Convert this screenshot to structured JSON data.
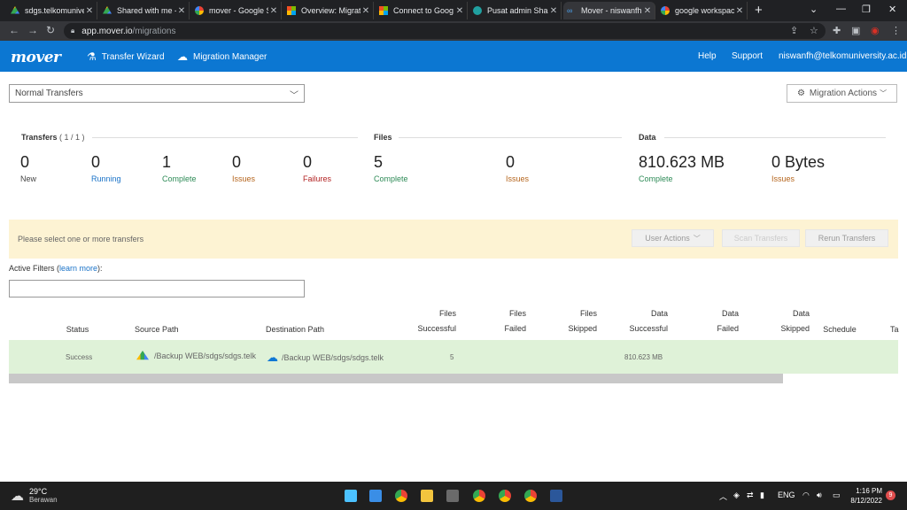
{
  "browser": {
    "tabs": [
      {
        "label": "sdgs.telkomunive",
        "icon": "google-drive-icon"
      },
      {
        "label": "Shared with me -",
        "icon": "google-drive-icon"
      },
      {
        "label": "mover - Google S",
        "icon": "google-icon"
      },
      {
        "label": "Overview: Migrat",
        "icon": "microsoft-icon"
      },
      {
        "label": "Connect to Goog",
        "icon": "microsoft-icon"
      },
      {
        "label": "Pusat admin Sha",
        "icon": "sharepoint-icon"
      },
      {
        "label": "Mover - niswanfh",
        "icon": "mover-icon"
      },
      {
        "label": "google workspac",
        "icon": "google-icon"
      }
    ],
    "url_host": "app.mover.io",
    "url_path": "/migrations"
  },
  "header": {
    "logo": "mover",
    "nav": [
      {
        "label": "Transfer Wizard",
        "icon": "flask-icon"
      },
      {
        "label": "Migration Manager",
        "icon": "cloud-upload-icon"
      }
    ],
    "help": "Help",
    "support": "Support",
    "user": "niswanfh@telkomuniversity.ac.id"
  },
  "main": {
    "transfer_type": "Normal Transfers",
    "migration_actions": "Migration Actions",
    "transfers_head": "Transfers",
    "transfers_count": "( 1 / 1 )",
    "files_head": "Files",
    "data_head": "Data",
    "stats": [
      {
        "value": "0",
        "label": "New"
      },
      {
        "value": "0",
        "label": "Running"
      },
      {
        "value": "1",
        "label": "Complete"
      },
      {
        "value": "0",
        "label": "Issues"
      },
      {
        "value": "0",
        "label": "Failures"
      },
      {
        "value": "5",
        "label": "Complete"
      },
      {
        "value": "0",
        "label": "Issues"
      },
      {
        "value": "810.623 MB",
        "label": "Complete"
      },
      {
        "value": "0 Bytes",
        "label": "Issues"
      }
    ],
    "banner_msg": "Please select one or more transfers",
    "user_actions": "User Actions",
    "scan_transfers": "Scan Transfers",
    "rerun_transfers": "Rerun Transfers",
    "active_filters": "Active Filters (",
    "learn_more": "learn more",
    "active_filters_end": "):"
  },
  "table": {
    "columns": {
      "status": "Status",
      "source": "Source Path",
      "destination": "Destination Path",
      "files_successful_1": "Files",
      "files_successful_2": "Successful",
      "files_failed_1": "Files",
      "files_failed_2": "Failed",
      "files_skipped_1": "Files",
      "files_skipped_2": "Skipped",
      "data_successful_1": "Data",
      "data_successful_2": "Successful",
      "data_failed_1": "Data",
      "data_failed_2": "Failed",
      "data_skipped_1": "Data",
      "data_skipped_2": "Skipped",
      "schedule": "Schedule",
      "extra": "Ta"
    },
    "rows": [
      {
        "status": "Success",
        "source": "/Backup WEB/sdgs/sdgs.telk",
        "destination": "/Backup WEB/sdgs/sdgs.telk",
        "files_successful": "5",
        "data_successful": "810.623 MB"
      }
    ]
  },
  "taskbar": {
    "temp": "29°C",
    "weather": "Berawan",
    "lang": "ENG",
    "time": "1:16 PM",
    "date": "8/12/2022",
    "notifications": "9"
  }
}
